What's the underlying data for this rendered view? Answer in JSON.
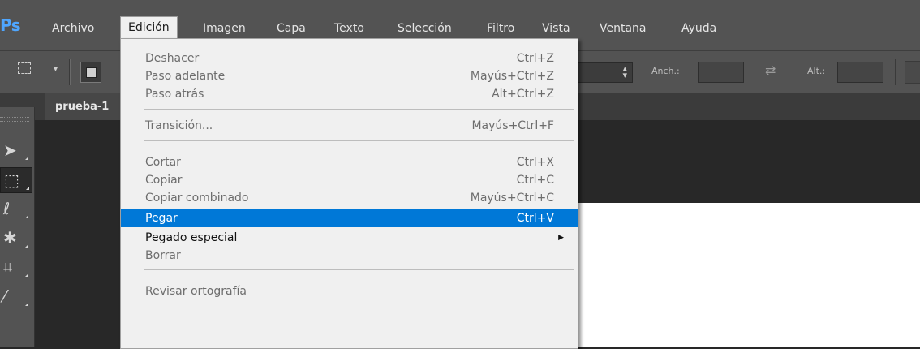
{
  "app": {
    "logo": "Ps",
    "accent_color": "#4fa6ff",
    "highlight_color": "#0078d7"
  },
  "menubar": {
    "items": [
      "Archivo",
      "Edición",
      "Imagen",
      "Capa",
      "Texto",
      "Selección",
      "Filtro",
      "Vista",
      "Ventana",
      "Ayuda"
    ],
    "active": "Edición"
  },
  "options": {
    "width_label": "Anch.:",
    "height_label": "Alt.:",
    "swap_icon": "swap-arrows-icon"
  },
  "document": {
    "tab_title": "prueba-1"
  },
  "tools": [
    "move-tool-icon",
    "rectangular-marquee-icon",
    "lasso-icon",
    "magic-wand-icon",
    "crop-icon",
    "eyedropper-icon"
  ],
  "edit_menu": {
    "items": [
      {
        "label": "Deshacer",
        "shortcut": "Ctrl+Z",
        "enabled": false
      },
      {
        "label": "Paso adelante",
        "shortcut": "Mayús+Ctrl+Z",
        "enabled": false
      },
      {
        "label": "Paso atrás",
        "shortcut": "Alt+Ctrl+Z",
        "enabled": false
      },
      {
        "label": "Transición...",
        "shortcut": "Mayús+Ctrl+F",
        "enabled": false
      },
      {
        "label": "Cortar",
        "shortcut": "Ctrl+X",
        "enabled": false
      },
      {
        "label": "Copiar",
        "shortcut": "Ctrl+C",
        "enabled": false
      },
      {
        "label": "Copiar combinado",
        "shortcut": "Mayús+Ctrl+C",
        "enabled": false
      },
      {
        "label": "Pegar",
        "shortcut": "Ctrl+V",
        "enabled": true,
        "highlighted": true
      },
      {
        "label": "Pegado especial",
        "shortcut": "",
        "enabled": true,
        "submenu": true
      },
      {
        "label": "Borrar",
        "shortcut": "",
        "enabled": false
      },
      {
        "label": "Revisar ortografía",
        "shortcut": "",
        "enabled": false
      }
    ]
  }
}
